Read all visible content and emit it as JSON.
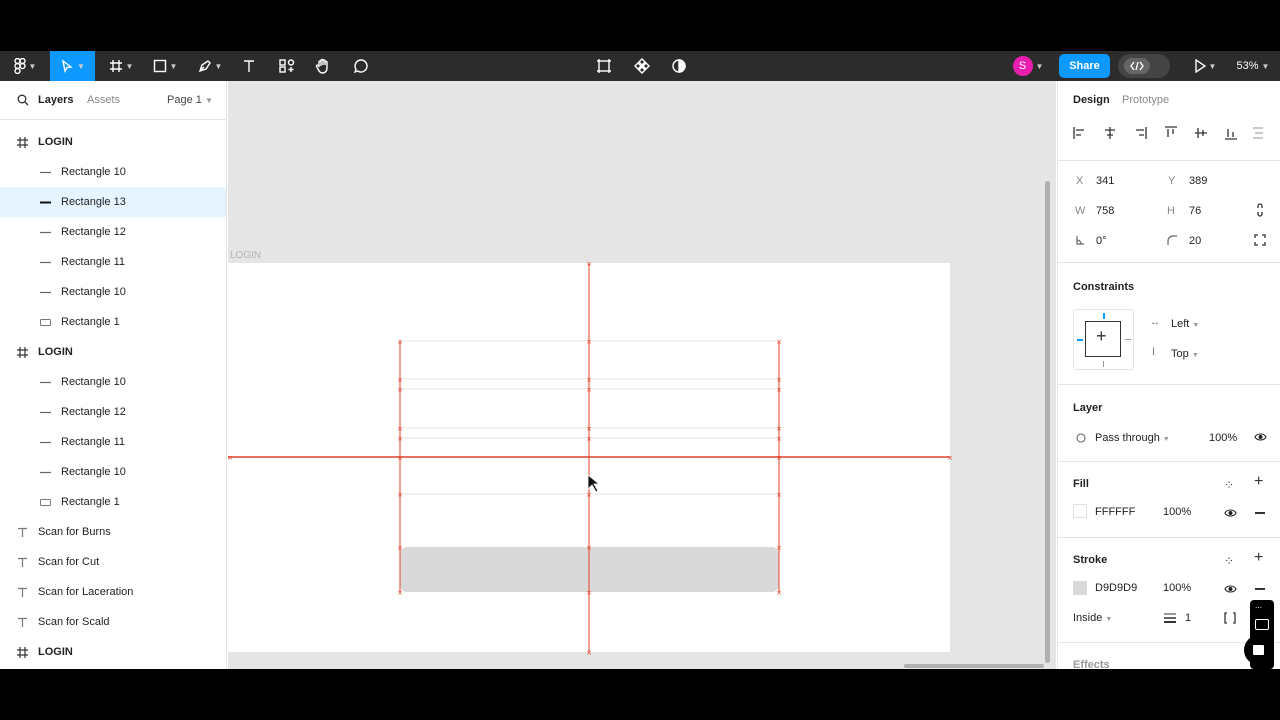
{
  "toolbar": {
    "avatar_initial": "S",
    "share_label": "Share",
    "zoom": "53%"
  },
  "left_panel": {
    "tabs": {
      "layers": "Layers",
      "assets": "Assets"
    },
    "page_selector": "Page 1",
    "layers": [
      {
        "name": "LOGIN",
        "kind": "frame",
        "indent": false,
        "selected": false
      },
      {
        "name": "Rectangle 10",
        "kind": "line",
        "indent": true,
        "selected": false
      },
      {
        "name": "Rectangle 13",
        "kind": "line",
        "indent": true,
        "selected": true
      },
      {
        "name": "Rectangle 12",
        "kind": "line",
        "indent": true,
        "selected": false
      },
      {
        "name": "Rectangle 11",
        "kind": "line",
        "indent": true,
        "selected": false
      },
      {
        "name": "Rectangle 10",
        "kind": "line",
        "indent": true,
        "selected": false
      },
      {
        "name": "Rectangle 1",
        "kind": "rect",
        "indent": true,
        "selected": false
      },
      {
        "name": "LOGIN",
        "kind": "frame",
        "indent": false,
        "selected": false
      },
      {
        "name": "Rectangle 10",
        "kind": "line",
        "indent": true,
        "selected": false
      },
      {
        "name": "Rectangle 12",
        "kind": "line",
        "indent": true,
        "selected": false
      },
      {
        "name": "Rectangle 11",
        "kind": "line",
        "indent": true,
        "selected": false
      },
      {
        "name": "Rectangle 10",
        "kind": "line",
        "indent": true,
        "selected": false
      },
      {
        "name": "Rectangle 1",
        "kind": "rect",
        "indent": true,
        "selected": false
      },
      {
        "name": "Scan for Burns",
        "kind": "text",
        "indent": false,
        "selected": false
      },
      {
        "name": "Scan for Cut",
        "kind": "text",
        "indent": false,
        "selected": false
      },
      {
        "name": "Scan for Laceration",
        "kind": "text",
        "indent": false,
        "selected": false
      },
      {
        "name": "Scan for Scald",
        "kind": "text",
        "indent": false,
        "selected": false
      },
      {
        "name": "LOGIN",
        "kind": "frame",
        "indent": false,
        "selected": false
      }
    ]
  },
  "canvas": {
    "frame_label": "LOGIN"
  },
  "design_panel": {
    "tabs": {
      "design": "Design",
      "prototype": "Prototype"
    },
    "x_label": "X",
    "x": "341",
    "y_label": "Y",
    "y": "389",
    "w_label": "W",
    "w": "758",
    "h_label": "H",
    "h": "76",
    "rotation": "0°",
    "radius": "20",
    "constraints_title": "Constraints",
    "constraint_h": "Left",
    "constraint_v": "Top",
    "layer_title": "Layer",
    "blend": "Pass through",
    "layer_opacity": "100%",
    "fill_title": "Fill",
    "fill_hex": "FFFFFF",
    "fill_opacity": "100%",
    "fill_color": "#FFFFFF",
    "stroke_title": "Stroke",
    "stroke_hex": "D9D9D9",
    "stroke_opacity": "100%",
    "stroke_color": "#D9D9D9",
    "stroke_position": "Inside",
    "stroke_weight": "1",
    "effects_title": "Effects"
  },
  "colors": {
    "accent": "#0d99ff",
    "selection_red": "#e0412b",
    "avatar": "#e91eaf"
  }
}
